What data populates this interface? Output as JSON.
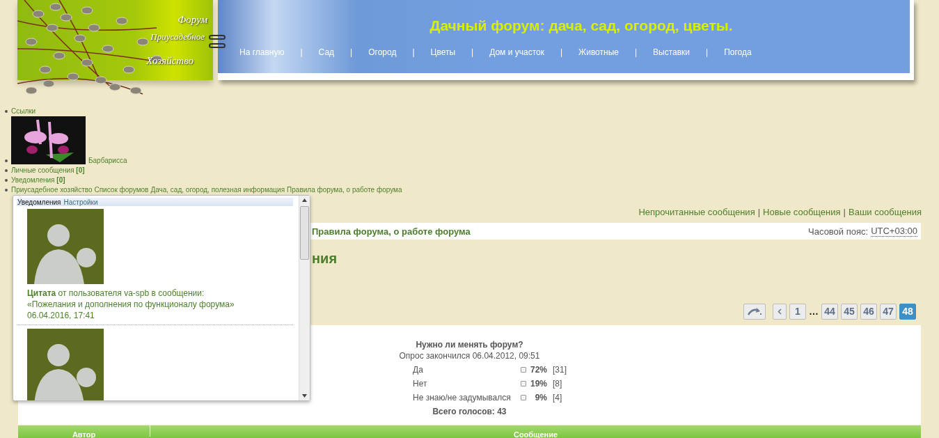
{
  "header": {
    "logo_lines": [
      "Форум",
      "Приусадебное",
      "Хозяйство"
    ],
    "title": "Дачный форум: дача, сад, огород, цветы.",
    "nav": [
      "На главную",
      "Сад",
      "Огород",
      "Цветы",
      "Дом и участок",
      "Животные",
      "Выставки",
      "Погода"
    ],
    "nav_separator": "|"
  },
  "user_menu": {
    "links_label": "Ссылки",
    "username": "Барбарисса",
    "messages": {
      "label": "Личные сообщения",
      "count": "[0]"
    },
    "notifications": {
      "label": "Уведомления",
      "count": "[0]"
    }
  },
  "breadcrumbs": [
    "Приусадебное хозяйство",
    "Список форумов",
    "Дача, сад, огород, полезная информация",
    "Правила форума, о работе форума"
  ],
  "quick_links": {
    "items": [
      "Непрочитанные сообщения",
      "Новые сообщения",
      "Ваши сообщения"
    ],
    "separator": "|"
  },
  "nav_bar": {
    "forum": "Правила форума, о работе форума",
    "timezone_label": "Часовой пояс:",
    "timezone": "UTC+03:00"
  },
  "topic_title": "ния",
  "pagination": [
    {
      "kind": "page",
      "label": "1",
      "selected": false
    },
    {
      "kind": "ellipsis",
      "label": "…"
    },
    {
      "kind": "page",
      "label": "44",
      "selected": false
    },
    {
      "kind": "page",
      "label": "45",
      "selected": false
    },
    {
      "kind": "page",
      "label": "46",
      "selected": false
    },
    {
      "kind": "page",
      "label": "47",
      "selected": false
    },
    {
      "kind": "page",
      "label": "48",
      "selected": true
    }
  ],
  "poll": {
    "question": "Нужно ли менять форум?",
    "status": "Опрос закончился 06.04.2012, 09:51",
    "options": [
      {
        "label": "Да",
        "percent": "72%",
        "votes": "[31]"
      },
      {
        "label": "Нет",
        "percent": "19%",
        "votes": "[8]"
      },
      {
        "label": "Не знаю/не задумывался",
        "percent": "9%",
        "votes": "[4]"
      }
    ],
    "total": "Всего голосов: 43"
  },
  "table": {
    "columns": [
      "Автор",
      "Сообщение"
    ]
  },
  "notifications_popup": {
    "title": "Уведомления",
    "settings": "Настройки",
    "items": [
      {
        "kind": "quote",
        "text": "**Цитата** от пользователя va-spb в сообщении:",
        "topic": "«Пожелания и дополнения по функционалу форума»",
        "time": "06.04.2016, 17:41"
      },
      {
        "kind": "avatar"
      }
    ]
  }
}
